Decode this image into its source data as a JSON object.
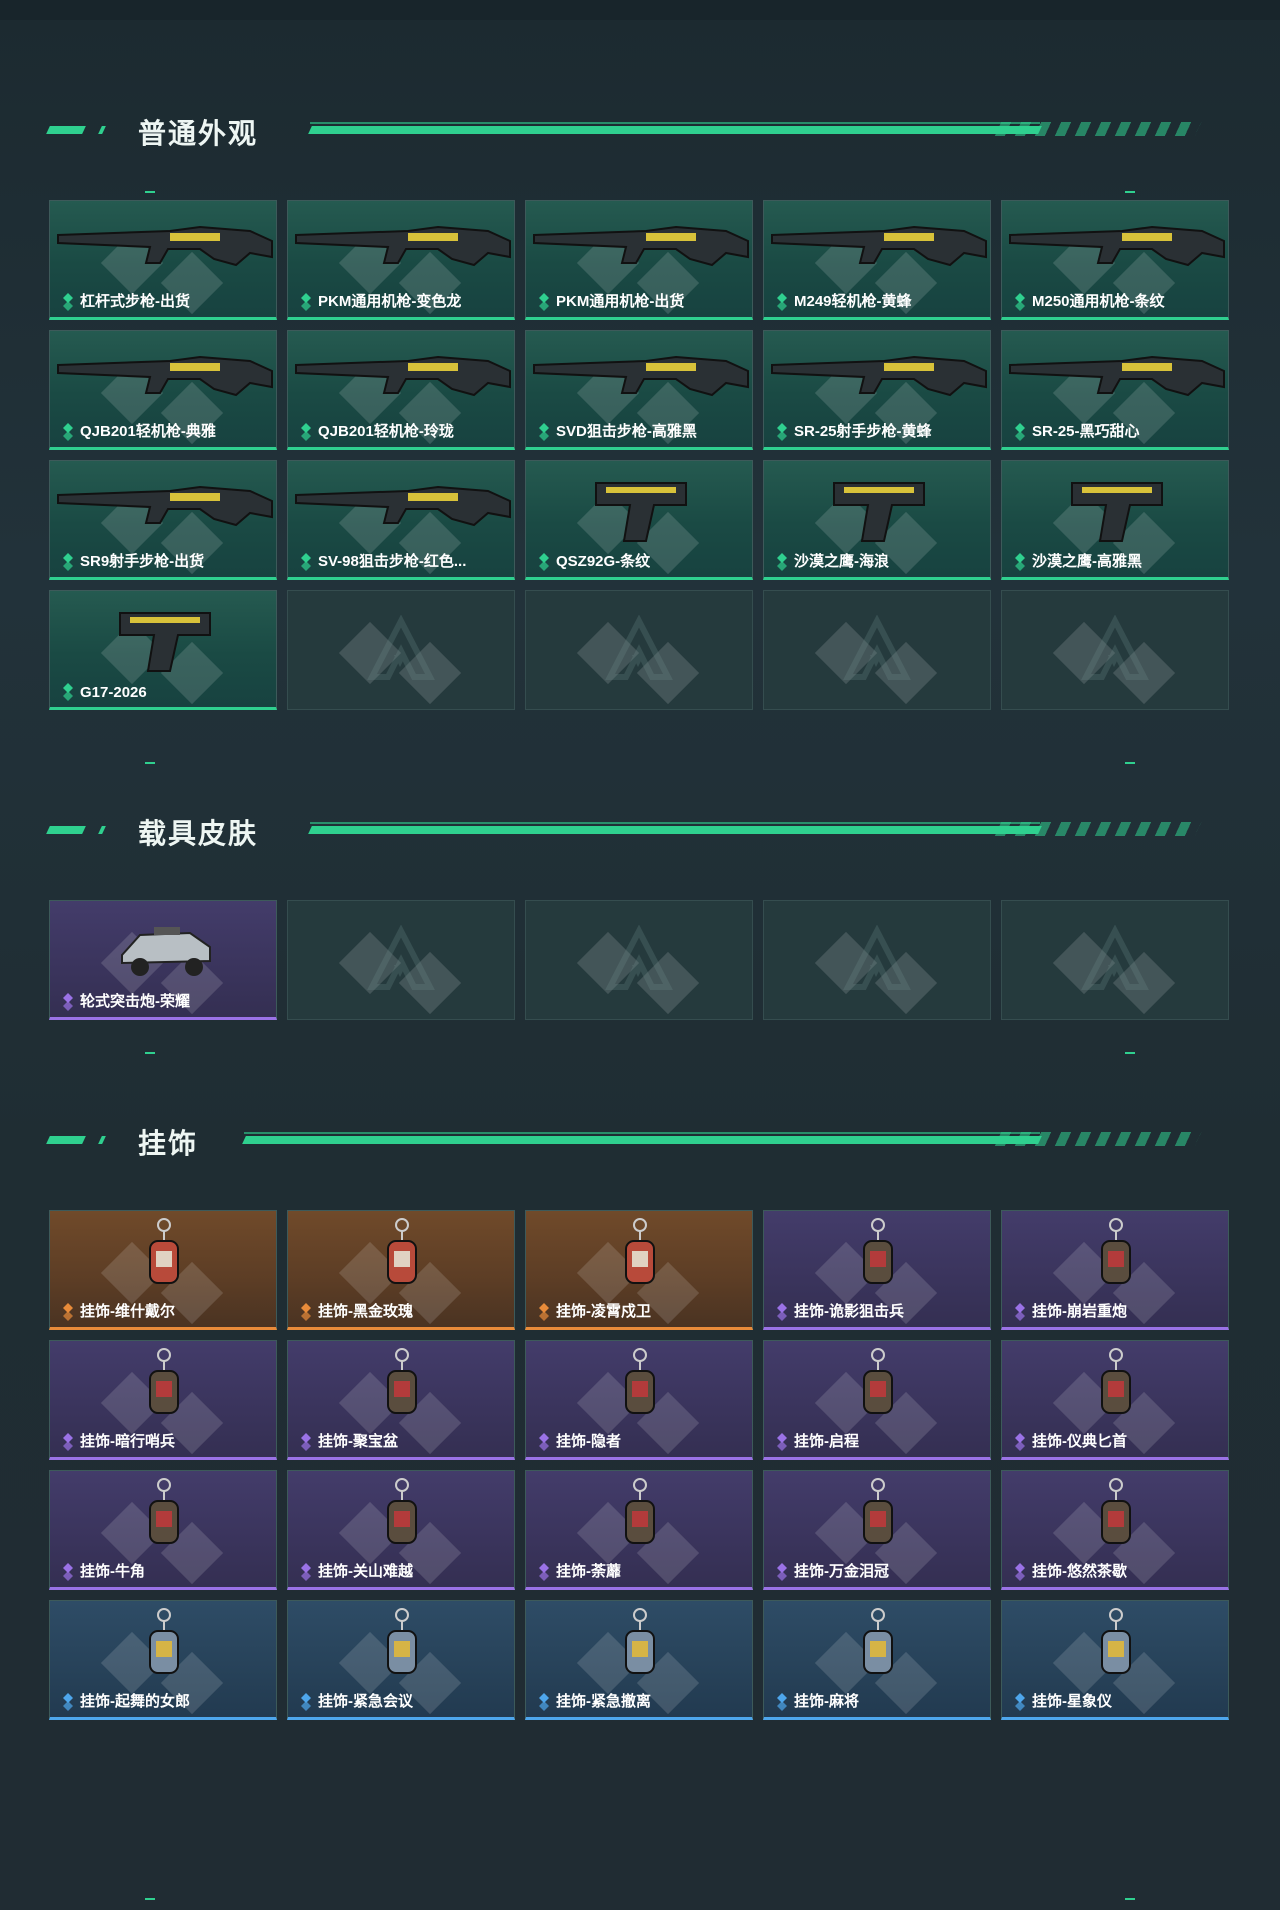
{
  "sections": [
    {
      "title": "普通外观",
      "items": [
        {
          "label": "杠杆式步枪-出货",
          "icon": "lever-rifle-icon",
          "tier": "green"
        },
        {
          "label": "PKM通用机枪-变色龙",
          "icon": "pkm-machine-gun-icon",
          "tier": "green"
        },
        {
          "label": "PKM通用机枪-出货",
          "icon": "pkm-machine-gun-icon",
          "tier": "green"
        },
        {
          "label": "M249轻机枪-黄蜂",
          "icon": "m249-light-machine-gun-icon",
          "tier": "green"
        },
        {
          "label": "M250通用机枪-条纹",
          "icon": "m250-machine-gun-icon",
          "tier": "green"
        },
        {
          "label": "QJB201轻机枪-典雅",
          "icon": "qjb201-light-machine-gun-icon",
          "tier": "green"
        },
        {
          "label": "QJB201轻机枪-玲珑",
          "icon": "qjb201-light-machine-gun-icon",
          "tier": "green"
        },
        {
          "label": "SVD狙击步枪-高雅黑",
          "icon": "svd-sniper-rifle-icon",
          "tier": "green"
        },
        {
          "label": "SR-25射手步枪-黄蜂",
          "icon": "sr25-marksman-rifle-icon",
          "tier": "green"
        },
        {
          "label": "SR-25-黑巧甜心",
          "icon": "sr25-rifle-icon",
          "tier": "green"
        },
        {
          "label": "SR9射手步枪-出货",
          "icon": "sr9-marksman-rifle-icon",
          "tier": "green"
        },
        {
          "label": "SV-98狙击步枪-红色...",
          "icon": "sv98-sniper-rifle-icon",
          "tier": "green"
        },
        {
          "label": "QSZ92G-条纹",
          "icon": "qsz92g-pistol-icon",
          "tier": "green"
        },
        {
          "label": "沙漠之鹰-海浪",
          "icon": "desert-eagle-pistol-icon",
          "tier": "green"
        },
        {
          "label": "沙漠之鹰-高雅黑",
          "icon": "desert-eagle-pistol-icon",
          "tier": "green"
        },
        {
          "label": "G17-2026",
          "icon": "g17-pistol-icon",
          "tier": "green"
        },
        {
          "label": "",
          "icon": "placeholder-logo-icon",
          "tier": "empty"
        },
        {
          "label": "",
          "icon": "placeholder-logo-icon",
          "tier": "empty"
        },
        {
          "label": "",
          "icon": "placeholder-logo-icon",
          "tier": "empty"
        },
        {
          "label": "",
          "icon": "placeholder-logo-icon",
          "tier": "empty"
        }
      ]
    },
    {
      "title": "载具皮肤",
      "items": [
        {
          "label": "轮式突击炮-荣耀",
          "icon": "wheeled-assault-vehicle-icon",
          "tier": "purple"
        },
        {
          "label": "",
          "icon": "placeholder-logo-icon",
          "tier": "empty"
        },
        {
          "label": "",
          "icon": "placeholder-logo-icon",
          "tier": "empty"
        },
        {
          "label": "",
          "icon": "placeholder-logo-icon",
          "tier": "empty"
        },
        {
          "label": "",
          "icon": "placeholder-logo-icon",
          "tier": "empty"
        }
      ]
    },
    {
      "title": "挂饰",
      "items": [
        {
          "label": "挂饰-维什戴尔",
          "icon": "keychain-charm-icon",
          "tier": "orange"
        },
        {
          "label": "挂饰-黑金玫瑰",
          "icon": "keychain-charm-icon",
          "tier": "orange"
        },
        {
          "label": "挂饰-凌霄戍卫",
          "icon": "keychain-charm-icon",
          "tier": "orange"
        },
        {
          "label": "挂饰-诡影狙击兵",
          "icon": "keychain-charm-icon",
          "tier": "purple"
        },
        {
          "label": "挂饰-崩岩重炮",
          "icon": "keychain-charm-icon",
          "tier": "purple"
        },
        {
          "label": "挂饰-暗行哨兵",
          "icon": "keychain-charm-icon",
          "tier": "purple"
        },
        {
          "label": "挂饰-聚宝盆",
          "icon": "keychain-charm-icon",
          "tier": "purple"
        },
        {
          "label": "挂饰-隐者",
          "icon": "keychain-charm-icon",
          "tier": "purple"
        },
        {
          "label": "挂饰-启程",
          "icon": "keychain-charm-icon",
          "tier": "purple"
        },
        {
          "label": "挂饰-仪典匕首",
          "icon": "keychain-charm-icon",
          "tier": "purple"
        },
        {
          "label": "挂饰-牛角",
          "icon": "keychain-charm-icon",
          "tier": "purple"
        },
        {
          "label": "挂饰-关山难越",
          "icon": "keychain-charm-icon",
          "tier": "purple"
        },
        {
          "label": "挂饰-荼蘼",
          "icon": "keychain-charm-icon",
          "tier": "purple"
        },
        {
          "label": "挂饰-万金泪冠",
          "icon": "keychain-charm-icon",
          "tier": "purple"
        },
        {
          "label": "挂饰-悠然茶歇",
          "icon": "keychain-charm-icon",
          "tier": "purple"
        },
        {
          "label": "挂饰-起舞的女郎",
          "icon": "keychain-charm-icon",
          "tier": "blue"
        },
        {
          "label": "挂饰-紧急会议",
          "icon": "keychain-charm-icon",
          "tier": "blue"
        },
        {
          "label": "挂饰-紧急撤离",
          "icon": "keychain-charm-icon",
          "tier": "blue"
        },
        {
          "label": "挂饰-麻将",
          "icon": "keychain-charm-icon",
          "tier": "blue"
        },
        {
          "label": "挂饰-星象仪",
          "icon": "keychain-charm-icon",
          "tier": "blue"
        }
      ]
    }
  ],
  "colors": {
    "accent": "#2fd08f",
    "green": "#2fd08f",
    "purple": "#9a72e6",
    "orange": "#e88b3a",
    "blue": "#4ea6ec"
  }
}
